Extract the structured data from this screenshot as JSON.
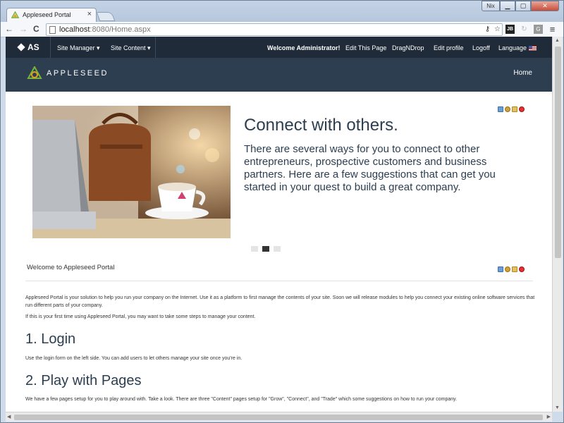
{
  "browser": {
    "tab_title": "Appleseed Portal",
    "tab_close": "×",
    "user_badge": "Nix",
    "url_host": "localhost",
    "url_path": ":8080/Home.aspx",
    "back": "←",
    "forward": "→",
    "reload": "C",
    "menu": "≡"
  },
  "adminbar": {
    "brand": "AS",
    "site_manager": "Site Manager ▾",
    "site_content": "Site Content ▾",
    "welcome": "Welcome Administrator!",
    "edit_page": "Edit This Page",
    "dragndrop": "DragNDrop",
    "edit_profile": "Edit profile",
    "logoff": "Logoff",
    "language": "Language"
  },
  "header": {
    "logo_text": "APPLESEED",
    "home": "Home"
  },
  "carousel": {
    "headline": "Connect with others.",
    "body": "There are several ways for you to connect to other entrepreneurs, prospective customers and business partners. Here are a few suggestions that can get you started in your quest to build a great company.",
    "slides": 3,
    "active_slide": 2
  },
  "content": {
    "welcome_title": "Welcome to Appleseed Portal",
    "intro": "Appleseed Portal is your solution to help you run your company on the Internet. Use it as a platform to first manage the contents of your site. Soon we will release modules to help you connect your existing online software services that run different parts of your company.",
    "first_time": "If this is your first time using Appleseed Portal, you may want to take some steps to manage your content.",
    "step1_title": "1. Login",
    "step1_text": "Use the login form on the left side. You can add users to let others manage your site once you're in.",
    "step2_title": "2. Play with Pages",
    "step2_text": "We have a few pages setup for you to play around with. Take a look. There are three \"Content\" pages setup for \"Grow\", \"Connect\", and \"Trade\" which some suggestions on how to run your company."
  }
}
